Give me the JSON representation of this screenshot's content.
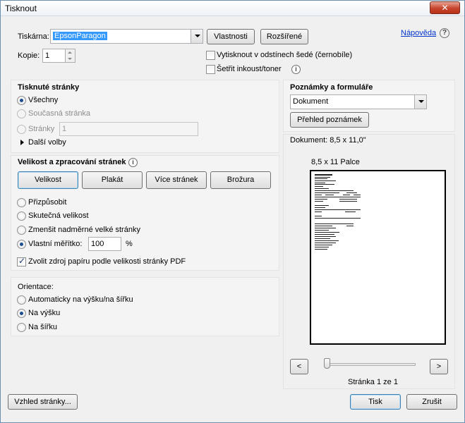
{
  "window": {
    "title": "Tisknout",
    "close_glyph": "✕"
  },
  "printer": {
    "label": "Tiskárna:",
    "selected": "EpsonParagon",
    "properties_button": "Vlastnosti",
    "advanced_button": "Rozšířené",
    "help_link": "Nápověda"
  },
  "copies": {
    "label": "Kopie:",
    "value": "1"
  },
  "options": {
    "grayscale": {
      "label": "Vytisknout v odstínech šedé (černobíle)",
      "checked": false
    },
    "save_ink": {
      "label": "Šetřit inkoust/toner",
      "checked": false
    }
  },
  "pages_panel": {
    "title": "Tisknuté stránky",
    "all_label": "Všechny",
    "current_label": "Současná stránka",
    "pages_label": "Stránky",
    "pages_value": "1",
    "more_options": "Další volby"
  },
  "sizing_panel": {
    "title": "Velikost a zpracování stránek",
    "tabs": [
      "Velikost",
      "Plakát",
      "Více stránek",
      "Brožura"
    ],
    "fit_label": "Přizpůsobit",
    "actual_label": "Skutečná velikost",
    "shrink_label": "Zmenšit nadměrné velké stránky",
    "custom_label": "Vlastní měřítko:",
    "custom_value": "100",
    "percent": "%",
    "paper_source_label": "Zvolit zdroj papíru podle velikosti stránky PDF",
    "paper_source_checked": true
  },
  "orientation": {
    "title": "Orientace:",
    "auto_label": "Automaticky na výšku/na šířku",
    "portrait_label": "Na výšku",
    "landscape_label": "Na šířku",
    "selected": "portrait"
  },
  "comments": {
    "title": "Poznámky a formuláře",
    "selected": "Dokument",
    "summary_button": "Přehled poznámek"
  },
  "preview": {
    "document_size": "Dokument: 8,5 x 11,0\"",
    "paper_size": "8,5 x 11 Palce",
    "page_status": "Stránka 1 ze 1",
    "prev_glyph": "<",
    "next_glyph": ">",
    "slider_position": 0
  },
  "footer": {
    "page_setup_button": "Vzhled stránky...",
    "print_button": "Tisk",
    "cancel_button": "Zrušit"
  },
  "icons": {
    "info": "i",
    "help": "?"
  }
}
